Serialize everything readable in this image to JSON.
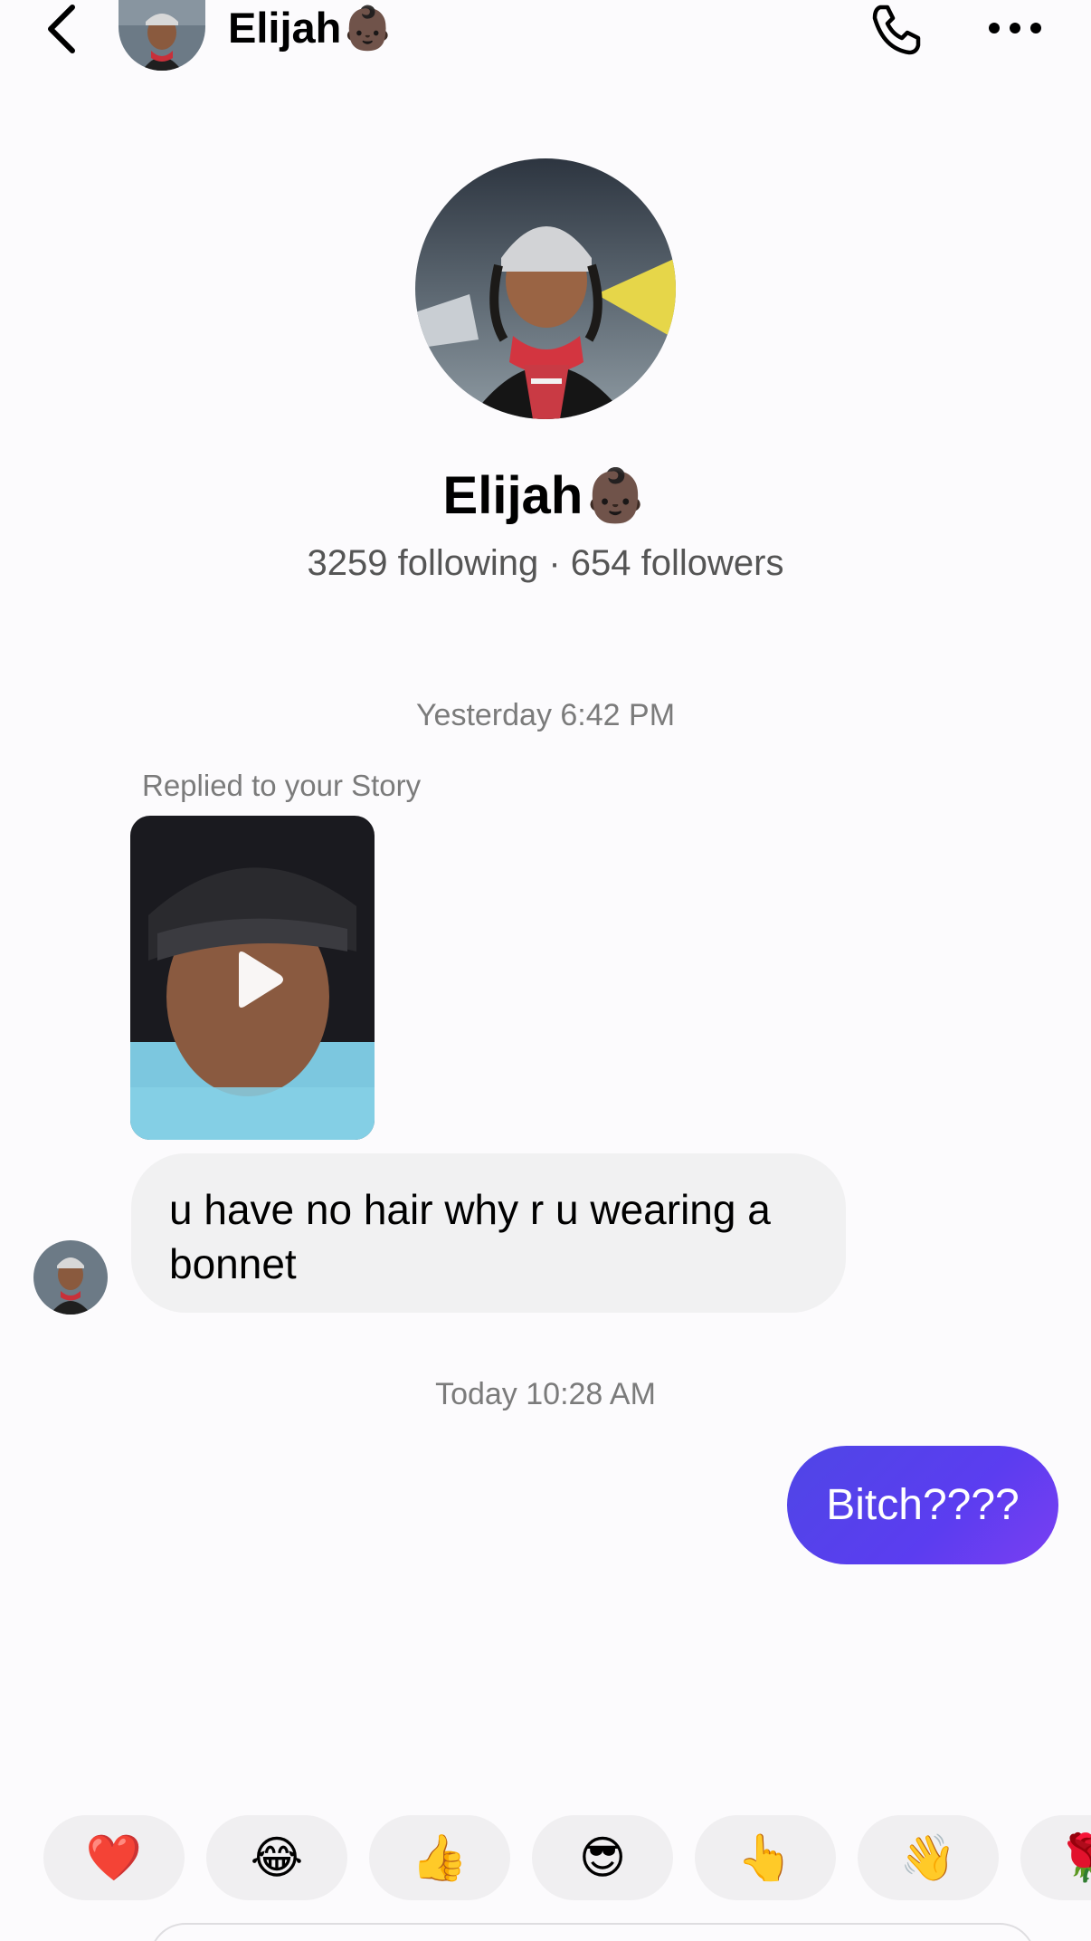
{
  "header": {
    "name": "Elijah👶🏿",
    "back_icon": "chevron-left-icon",
    "call_icon": "phone-icon",
    "more_icon": "more-horizontal-icon"
  },
  "profile": {
    "name": "Elijah👶🏿",
    "stats": "3259 following · 654 followers"
  },
  "thread": {
    "timestamp_1": "Yesterday 6:42 PM",
    "reply_label": "Replied to your Story",
    "incoming_message": "u have no hair why r u wearing a bonnet",
    "timestamp_2": "Today 10:28 AM",
    "outgoing_message": "Bitch????"
  },
  "reactions": [
    "❤️",
    "😂",
    "👍",
    "😎",
    "👆",
    "👋",
    "🌹"
  ],
  "colors": {
    "outgoing_bubble": "#5548ec",
    "incoming_bubble": "#f1f1f2",
    "reaction_pill": "#f0eff1"
  }
}
